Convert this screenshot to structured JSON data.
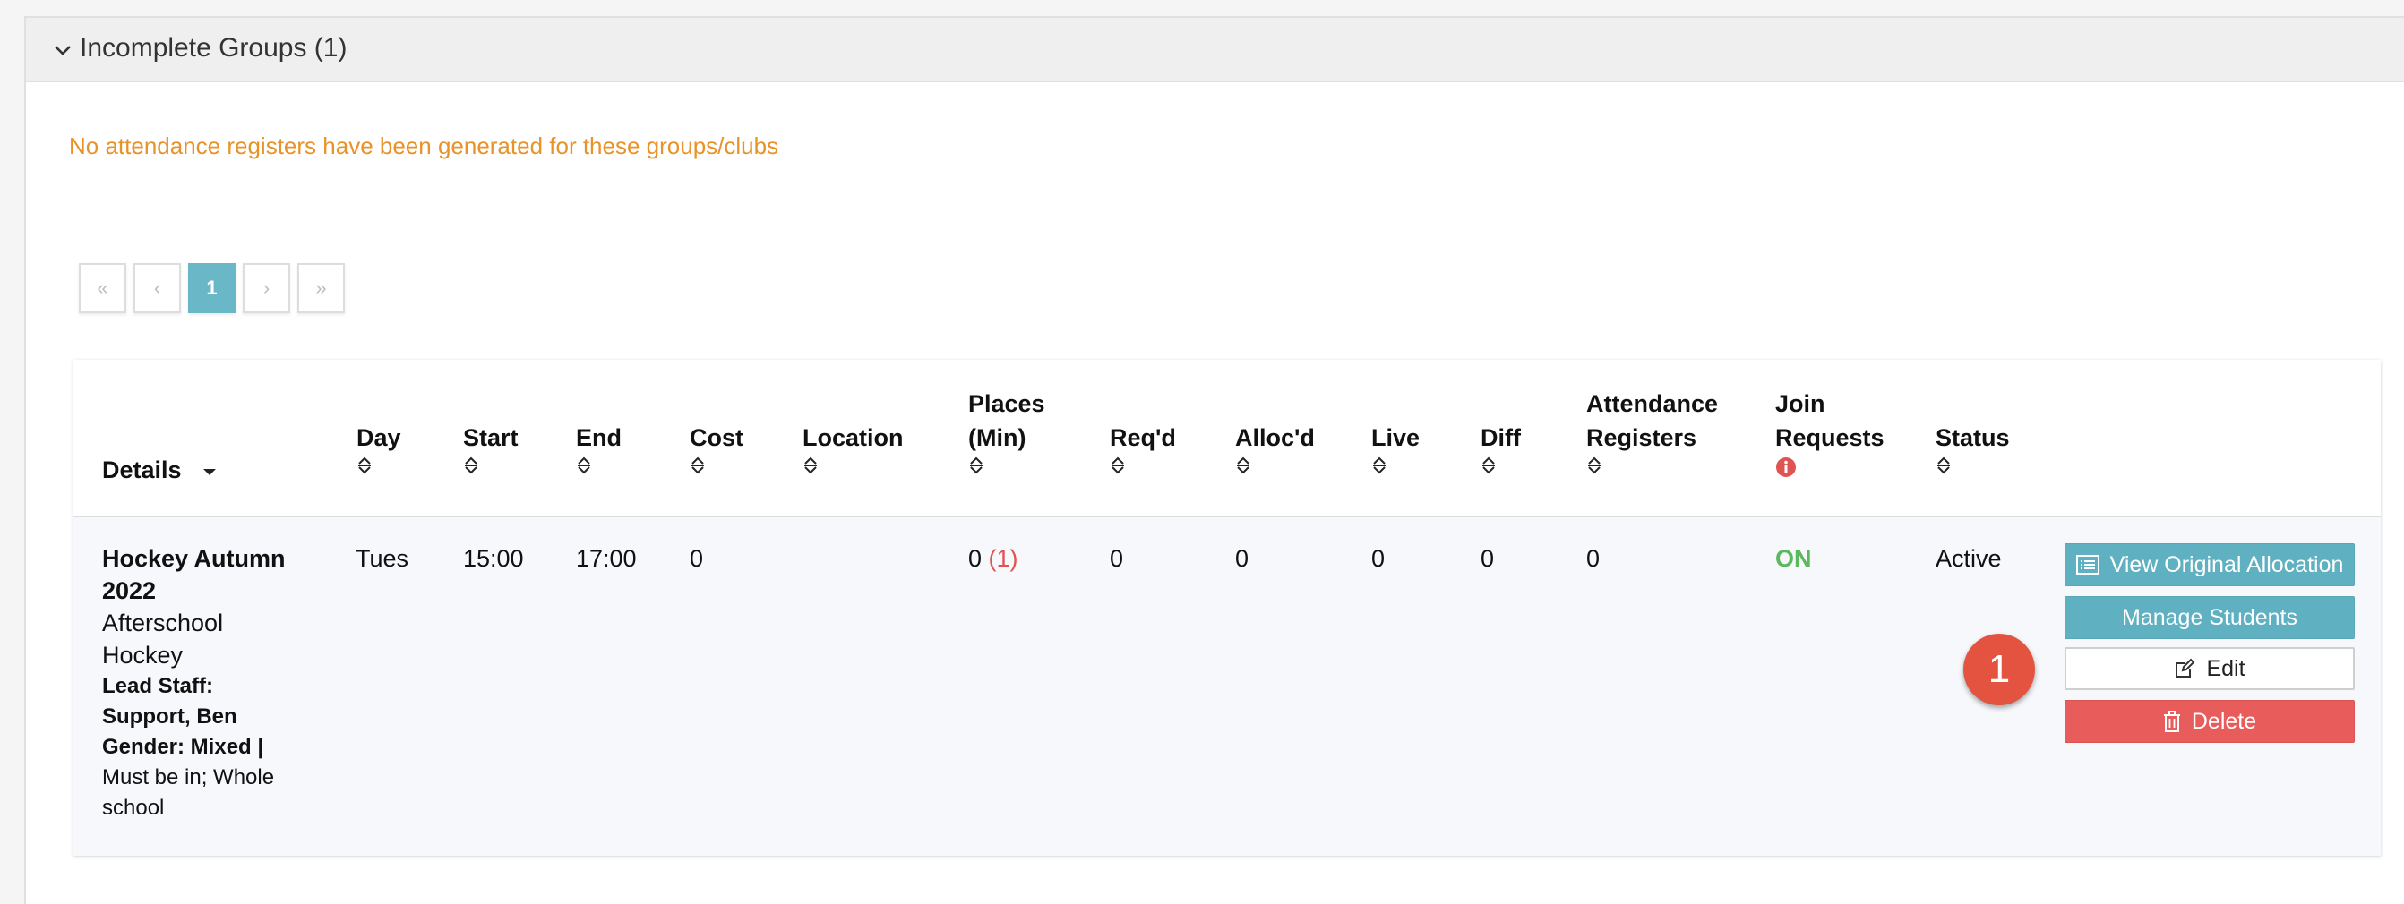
{
  "panel": {
    "title": "Incomplete Groups (1)",
    "notice": "No attendance registers have been generated for these groups/clubs"
  },
  "pagination": {
    "first": "«",
    "prev": "‹",
    "current": "1",
    "next": "›",
    "last": "»"
  },
  "table": {
    "headers": {
      "details": "Details",
      "day": "Day",
      "start": "Start",
      "end": "End",
      "cost": "Cost",
      "location": "Location",
      "places_line1": "Places",
      "places_line2": "(Min)",
      "reqd": "Req'd",
      "allocd": "Alloc'd",
      "live": "Live",
      "diff": "Diff",
      "attendance_line1": "Attendance",
      "attendance_line2": "Registers",
      "join_line1": "Join",
      "join_line2": "Requests",
      "status": "Status"
    },
    "row": {
      "title_line1": "Hockey Autumn",
      "title_line2": "2022",
      "subtitle_line1": "Afterschool",
      "subtitle_line2": "Hockey",
      "lead_line1": "Lead Staff:",
      "lead_line2": "Support, Ben",
      "gender": "Gender: Mixed |",
      "rule_line1": "Must be in; Whole",
      "rule_line2": "school",
      "day": "Tues",
      "start": "15:00",
      "end": "17:00",
      "cost": "0",
      "location": "",
      "places": "0",
      "places_min": "(1)",
      "reqd": "0",
      "allocd": "0",
      "live": "0",
      "diff": "0",
      "attendance_registers": "0",
      "join_requests": "ON",
      "status": "Active"
    },
    "actions": {
      "view_original": "View Original Allocation",
      "manage_students": "Manage Students",
      "edit": "Edit",
      "delete": "Delete"
    }
  },
  "annotation": {
    "step": "1"
  },
  "colors": {
    "accent_teal": "#5fb0c1",
    "notice_orange": "#e8932a",
    "danger_red": "#e85c5c",
    "on_green": "#5cb85c",
    "badge_red": "#e4533f"
  }
}
